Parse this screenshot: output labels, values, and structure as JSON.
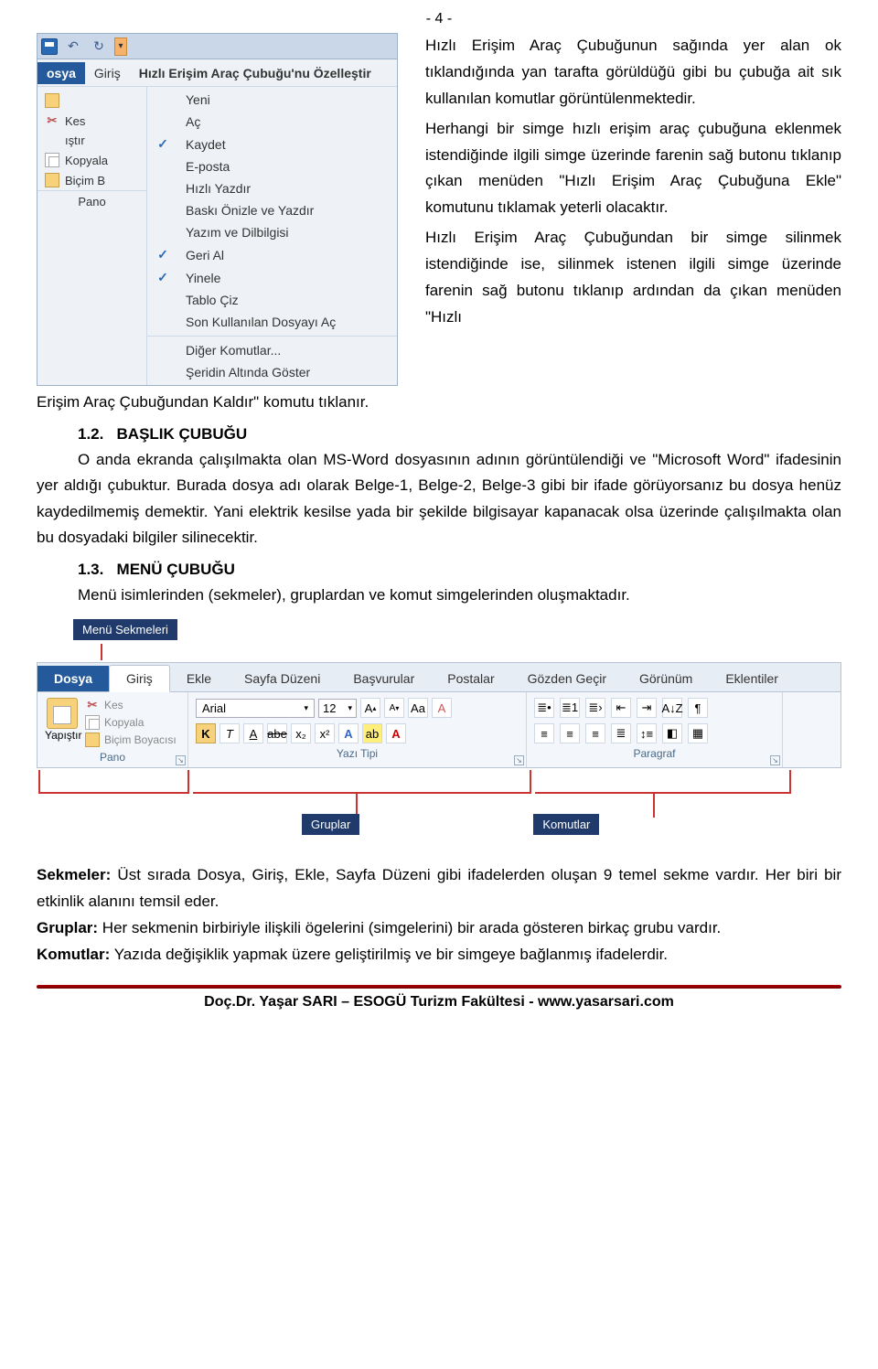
{
  "page_number": "- 4 -",
  "figure1": {
    "qat_title": "Hızlı Erişim Araç Çubuğu'nu Özelleştir",
    "file_tab": "osya",
    "giris_tab": "Giriş",
    "left_items": {
      "cut": "Kes",
      "copy": "Kopyala",
      "format": "Biçim B"
    },
    "left_paste": "ıştır",
    "pano": "Pano",
    "menu": {
      "new": "Yeni",
      "open": "Aç",
      "save": "Kaydet",
      "email": "E-posta",
      "quickprint": "Hızlı Yazdır",
      "preview": "Baskı Önizle ve Yazdır",
      "spell": "Yazım ve Dilbilgisi",
      "undo": "Geri Al",
      "redo": "Yinele",
      "table": "Tablo Çiz",
      "recent": "Son Kullanılan Dosyayı Aç",
      "more": "Diğer Komutlar...",
      "below": "Şeridin Altında Göster"
    }
  },
  "para1": "Hızlı Erişim Araç Çubuğunun sağında yer alan ok tıklandığında yan tarafta görüldüğü gibi bu çubuğa ait sık kullanılan komutlar görüntülenmektedir.",
  "para2": "Herhangi bir simge hızlı erişim araç çubuğuna eklenmek istendiğinde ilgili simge üzerinde farenin sağ butonu tıklanıp çıkan menüden \"Hızlı Erişim Araç Çubuğuna Ekle\" komutunu tıklamak yeterli olacaktır.",
  "para3": "Hızlı Erişim Araç Çubuğundan bir simge silinmek istendiğinde ise, silinmek istenen ilgili simge üzerinde farenin sağ butonu tıklanıp ardından da çıkan menüden \"Hızlı",
  "para3b": "Erişim Araç Çubuğundan Kaldır\" komutu tıklanır.",
  "h12_num": "1.2.",
  "h12": "BAŞLIK ÇUBUĞU",
  "p12": "O anda ekranda çalışılmakta olan MS-Word dosyasının adının görüntülendiği ve \"Microsoft Word\" ifadesinin yer aldığı çubuktur. Burada dosya adı olarak Belge-1, Belge-2, Belge-3 gibi bir ifade görüyorsanız bu dosya henüz kaydedilmemiş demektir. Yani elektrik kesilse yada bir şekilde bilgisayar kapanacak olsa üzerinde çalışılmakta olan bu dosyadaki bilgiler silinecektir.",
  "h13_num": "1.3.",
  "h13": "MENÜ ÇUBUĞU",
  "p13": "Menü isimlerinden (sekmeler), gruplardan ve komut simgelerinden oluşmaktadır.",
  "tag_menusekme": "Menü Sekmeleri",
  "tag_gruplar": "Gruplar",
  "tag_komutlar": "Komutlar",
  "ribbon": {
    "tabs": {
      "file": "Dosya",
      "home": "Giriş",
      "insert": "Ekle",
      "layout": "Sayfa Düzeni",
      "refs": "Başvurular",
      "mail": "Postalar",
      "review": "Gözden Geçir",
      "view": "Görünüm",
      "addins": "Eklentiler"
    },
    "clip": {
      "paste": "Yapıştır",
      "cut": "Kes",
      "copy": "Kopyala",
      "format": "Biçim Boyacısı",
      "group": "Pano"
    },
    "font": {
      "name": "Arial",
      "size": "12",
      "group": "Yazı Tipi",
      "bold": "K",
      "italic": "T",
      "under": "A",
      "strike": "abe",
      "sub": "x₂",
      "sup": "x²",
      "grow": "A",
      "shrink": "A",
      "case": "Aa",
      "clear": "A",
      "hl": "ab",
      "color": "A"
    },
    "para": {
      "group": "Paragraf",
      "sort": "A↓Z",
      "pilcrow": "¶"
    }
  },
  "bt_sekmeler_label": "Sekmeler:",
  "bt_sekmeler": " Üst sırada Dosya, Giriş, Ekle, Sayfa Düzeni gibi ifadelerden oluşan 9 temel sekme vardır. Her biri bir etkinlik alanını temsil eder.",
  "bt_gruplar_label": "Gruplar:",
  "bt_gruplar": " Her sekmenin birbiriyle ilişkili ögelerini (simgelerini) bir arada gösteren birkaç grubu vardır.",
  "bt_komutlar_label": "Komutlar:",
  "bt_komutlar": " Yazıda değişiklik yapmak üzere geliştirilmiş ve bir simgeye bağlanmış ifadelerdir.",
  "footer": "Doç.Dr. Yaşar SARI – ESOGÜ Turizm Fakültesi - www.yasarsari.com"
}
